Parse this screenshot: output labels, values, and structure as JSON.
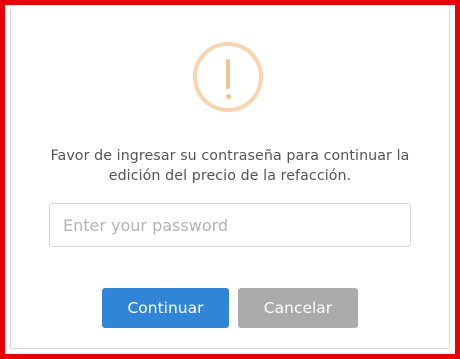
{
  "dialog": {
    "icon": "warning-exclamation-icon",
    "message": "Favor de ingresar su contraseña para continuar la edición del precio de la refacción.",
    "password_input": {
      "value": "",
      "placeholder": "Enter your password"
    },
    "confirm_label": "Continuar",
    "cancel_label": "Cancelar"
  },
  "colors": {
    "frame_border": "#e8000b",
    "icon": "#f8bb86",
    "confirm_button": "#3085d6",
    "cancel_button": "#aaaaaa",
    "text": "#545454"
  }
}
